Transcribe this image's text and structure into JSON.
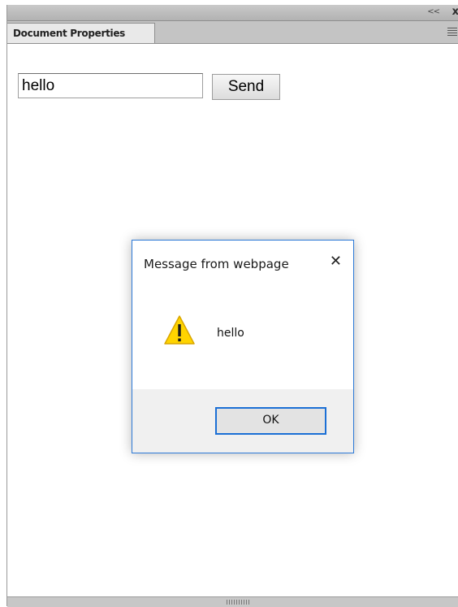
{
  "panel": {
    "tab_label": "Document Properties",
    "collapse_glyph": "<<",
    "close_glyph": "x",
    "menu_icon": "panel-menu-icon"
  },
  "form": {
    "input_value": "hello",
    "send_label": "Send"
  },
  "dialog": {
    "title": "Message from webpage",
    "close_glyph": "✕",
    "message": "hello",
    "icon": "warning-icon",
    "ok_label": "OK"
  },
  "colors": {
    "dialog_border": "#2b79d7",
    "ok_focus": "#1b6fd5",
    "warning_fill": "#ffd400"
  }
}
